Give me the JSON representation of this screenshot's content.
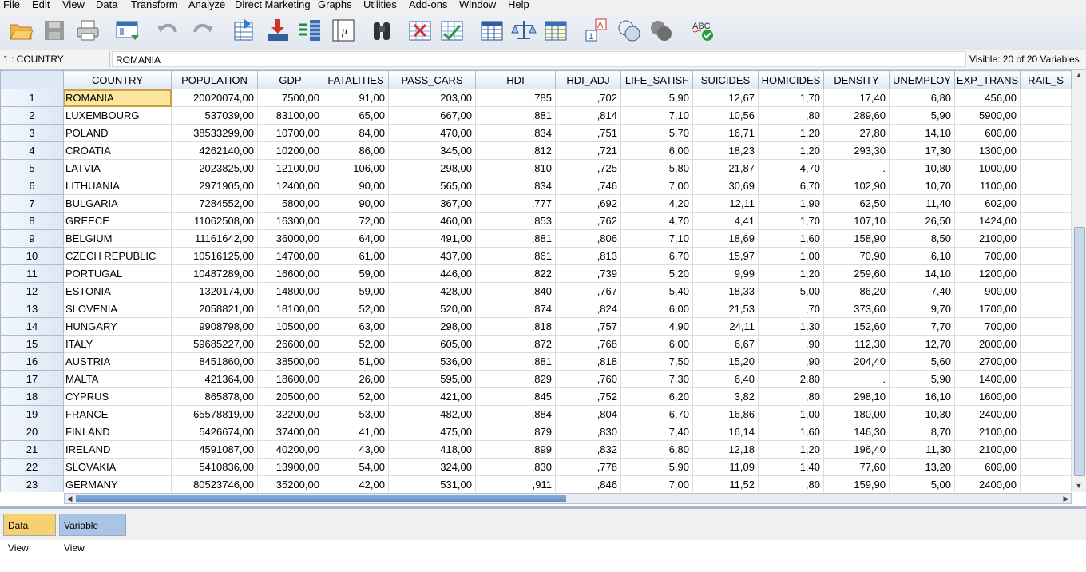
{
  "menu": [
    "File",
    "Edit",
    "View",
    "Data",
    "Transform",
    "Analyze",
    "Direct Marketing",
    "Graphs",
    "Utilities",
    "Add-ons",
    "Window",
    "Help"
  ],
  "cellbar": {
    "cell_ref": "1 : COUNTRY",
    "cell_value": "ROMANIA",
    "visible": "Visible: 20 of 20 Variables"
  },
  "columns": [
    "COUNTRY",
    "POPULATION",
    "GDP",
    "FATALITIES",
    "PASS_CARS",
    "HDI",
    "HDI_ADJ",
    "LIFE_SATISF",
    "SUICIDES",
    "HOMICIDES",
    "DENSITY",
    "UNEMPLOY",
    "EXP_TRANS",
    "RAIL_S"
  ],
  "rows": [
    [
      "1",
      "ROMANIA",
      "20020074,00",
      "7500,00",
      "91,00",
      "203,00",
      ",785",
      ",702",
      "5,90",
      "12,67",
      "1,70",
      "17,40",
      "6,80",
      "456,00",
      ""
    ],
    [
      "2",
      "LUXEMBOURG",
      "537039,00",
      "83100,00",
      "65,00",
      "667,00",
      ",881",
      ",814",
      "7,10",
      "10,56",
      ",80",
      "289,60",
      "5,90",
      "5900,00",
      ""
    ],
    [
      "3",
      "POLAND",
      "38533299,00",
      "10700,00",
      "84,00",
      "470,00",
      ",834",
      ",751",
      "5,70",
      "16,71",
      "1,20",
      "27,80",
      "14,10",
      "600,00",
      ""
    ],
    [
      "4",
      "CROATIA",
      "4262140,00",
      "10200,00",
      "86,00",
      "345,00",
      ",812",
      ",721",
      "6,00",
      "18,23",
      "1,20",
      "293,30",
      "17,30",
      "1300,00",
      ""
    ],
    [
      "5",
      "LATVIA",
      "2023825,00",
      "12100,00",
      "106,00",
      "298,00",
      ",810",
      ",725",
      "5,80",
      "21,87",
      "4,70",
      ".",
      "10,80",
      "1000,00",
      ""
    ],
    [
      "6",
      "LITHUANIA",
      "2971905,00",
      "12400,00",
      "90,00",
      "565,00",
      ",834",
      ",746",
      "7,00",
      "30,69",
      "6,70",
      "102,90",
      "10,70",
      "1100,00",
      ""
    ],
    [
      "7",
      "BULGARIA",
      "7284552,00",
      "5800,00",
      "90,00",
      "367,00",
      ",777",
      ",692",
      "4,20",
      "12,11",
      "1,90",
      "62,50",
      "11,40",
      "602,00",
      ""
    ],
    [
      "8",
      "GREECE",
      "11062508,00",
      "16300,00",
      "72,00",
      "460,00",
      ",853",
      ",762",
      "4,70",
      "4,41",
      "1,70",
      "107,10",
      "26,50",
      "1424,00",
      ""
    ],
    [
      "9",
      "BELGIUM",
      "11161642,00",
      "36000,00",
      "64,00",
      "491,00",
      ",881",
      ",806",
      "7,10",
      "18,69",
      "1,60",
      "158,90",
      "8,50",
      "2100,00",
      ""
    ],
    [
      "10",
      "CZECH REPUBLIC",
      "10516125,00",
      "14700,00",
      "61,00",
      "437,00",
      ",861",
      ",813",
      "6,70",
      "15,97",
      "1,00",
      "70,90",
      "6,10",
      "700,00",
      ""
    ],
    [
      "11",
      "PORTUGAL",
      "10487289,00",
      "16600,00",
      "59,00",
      "446,00",
      ",822",
      ",739",
      "5,20",
      "9,99",
      "1,20",
      "259,60",
      "14,10",
      "1200,00",
      ""
    ],
    [
      "12",
      "ESTONIA",
      "1320174,00",
      "14800,00",
      "59,00",
      "428,00",
      ",840",
      ",767",
      "5,40",
      "18,33",
      "5,00",
      "86,20",
      "7,40",
      "900,00",
      ""
    ],
    [
      "13",
      "SLOVENIA",
      "2058821,00",
      "18100,00",
      "52,00",
      "520,00",
      ",874",
      ",824",
      "6,00",
      "21,53",
      ",70",
      "373,60",
      "9,70",
      "1700,00",
      ""
    ],
    [
      "14",
      "HUNGARY",
      "9908798,00",
      "10500,00",
      "63,00",
      "298,00",
      ",818",
      ",757",
      "4,90",
      "24,11",
      "1,30",
      "152,60",
      "7,70",
      "700,00",
      ""
    ],
    [
      "15",
      "ITALY",
      "59685227,00",
      "26600,00",
      "52,00",
      "605,00",
      ",872",
      ",768",
      "6,00",
      "6,67",
      ",90",
      "112,30",
      "12,70",
      "2000,00",
      ""
    ],
    [
      "16",
      "AUSTRIA",
      "8451860,00",
      "38500,00",
      "51,00",
      "536,00",
      ",881",
      ",818",
      "7,50",
      "15,20",
      ",90",
      "204,40",
      "5,60",
      "2700,00",
      ""
    ],
    [
      "17",
      "MALTA",
      "421364,00",
      "18600,00",
      "26,00",
      "595,00",
      ",829",
      ",760",
      "7,30",
      "6,40",
      "2,80",
      ".",
      "5,90",
      "1400,00",
      ""
    ],
    [
      "18",
      "CYPRUS",
      "865878,00",
      "20500,00",
      "52,00",
      "421,00",
      ",845",
      ",752",
      "6,20",
      "3,82",
      ",80",
      "298,10",
      "16,10",
      "1600,00",
      ""
    ],
    [
      "19",
      "FRANCE",
      "65578819,00",
      "32200,00",
      "53,00",
      "482,00",
      ",884",
      ",804",
      "6,70",
      "16,86",
      "1,00",
      "180,00",
      "10,30",
      "2400,00",
      ""
    ],
    [
      "20",
      "FINLAND",
      "5426674,00",
      "37400,00",
      "41,00",
      "475,00",
      ",879",
      ",830",
      "7,40",
      "16,14",
      "1,60",
      "146,30",
      "8,70",
      "2100,00",
      ""
    ],
    [
      "21",
      "IRELAND",
      "4591087,00",
      "40200,00",
      "43,00",
      "418,00",
      ",899",
      ",832",
      "6,80",
      "12,18",
      "1,20",
      "196,40",
      "11,30",
      "2100,00",
      ""
    ],
    [
      "22",
      "SLOVAKIA",
      "5410836,00",
      "13900,00",
      "54,00",
      "324,00",
      ",830",
      ",778",
      "5,90",
      "11,09",
      "1,40",
      "77,60",
      "13,20",
      "600,00",
      ""
    ],
    [
      "23",
      "GERMANY",
      "80523746,00",
      "35200,00",
      "42,00",
      "531,00",
      ",911",
      ",846",
      "7,00",
      "11,52",
      ",80",
      "159,90",
      "5,00",
      "2400,00",
      ""
    ]
  ],
  "tabs": {
    "data_view": "Data View",
    "variable_view": "Variable View"
  },
  "toolbar_icons": [
    "open-icon",
    "save-icon",
    "print-icon",
    "recall-dialog-icon",
    "undo-icon",
    "redo-icon",
    "goto-case-icon",
    "goto-variable-icon",
    "variables-icon",
    "run-descriptives-icon",
    "find-icon",
    "insert-cases-icon",
    "insert-variable-icon",
    "split-file-icon",
    "weight-cases-icon",
    "select-cases-icon",
    "value-labels-icon",
    "use-sets-icon",
    "show-all-variables-icon",
    "spell-check-icon"
  ],
  "colors": {
    "selected_cell": "#fde7a0",
    "header_blue": "#dfe8f5",
    "active_tab": "#f8d070",
    "inactive_tab": "#a9c4e6"
  }
}
